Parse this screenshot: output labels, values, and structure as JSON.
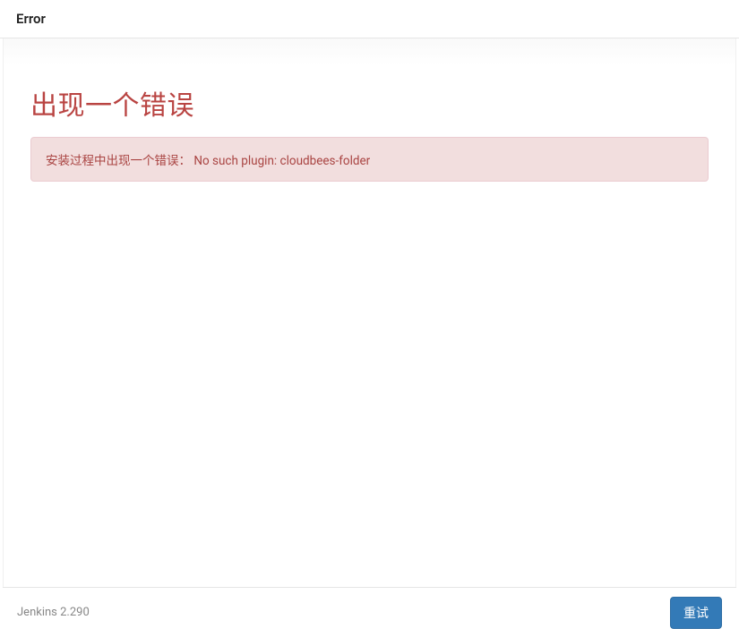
{
  "header": {
    "title": "Error"
  },
  "main": {
    "heading": "出现一个错误",
    "alert_message": "安装过程中出现一个错误： No such plugin: cloudbees-folder"
  },
  "footer": {
    "version_text": "Jenkins 2.290",
    "retry_label": "重试"
  },
  "colors": {
    "error_text": "#b94442",
    "alert_bg": "#f2dede",
    "alert_border": "#ebccd1",
    "button_primary": "#337ab7"
  }
}
